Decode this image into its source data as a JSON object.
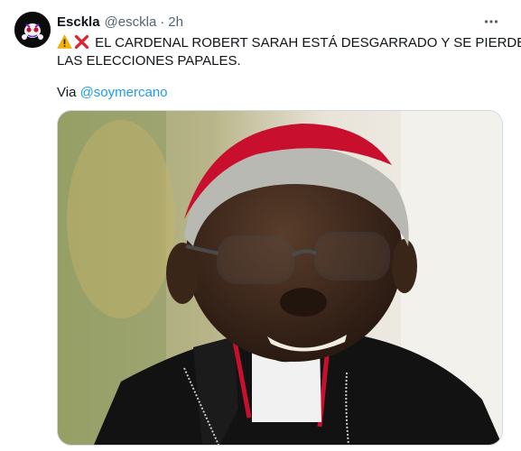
{
  "tweet": {
    "author_name": "Esckla",
    "author_handle": "@esckla",
    "separator": "·",
    "timestamp": "2h",
    "text_line1": "EL CARDENAL ROBERT SARAH ESTÁ DESGARRADO Y SE PIERDE",
    "text_line2": "LAS ELECCIONES PAPALES.",
    "via_prefix": "Via ",
    "via_mention": "@soymercano",
    "emojis": [
      "warning-emoji",
      "cross-mark-emoji"
    ]
  },
  "colors": {
    "accent": "#1d9bf0",
    "secondary_text": "#536471",
    "primary_text": "#0f1419",
    "cardinal_red": "#c8102e"
  }
}
